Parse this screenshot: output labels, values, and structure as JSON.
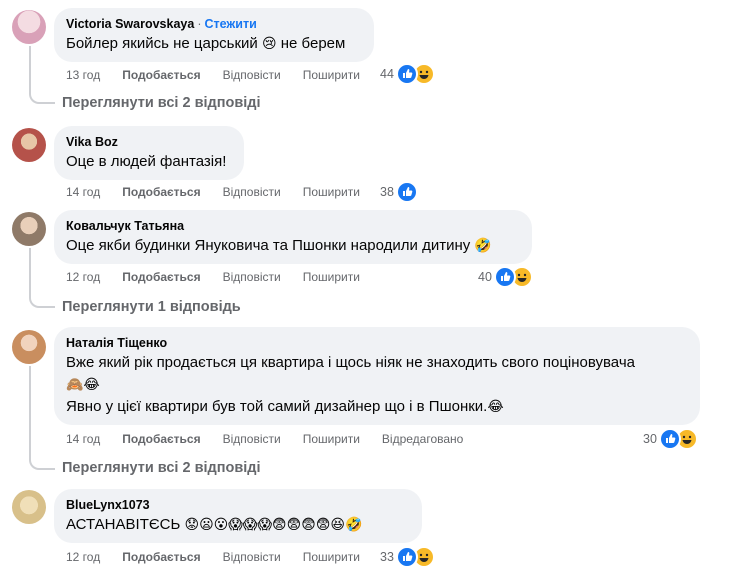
{
  "comments": [
    {
      "author": "Victoria Swarovskaya",
      "follow": "Стежити",
      "text": "Бойлер якийсь не царський",
      "text_emoji": "😢",
      "text_after": " не берем",
      "time": "13 год",
      "like": "Подобається",
      "reply": "Відповісти",
      "share": "Поширити",
      "reaction_count": "44",
      "reactions": [
        "like-icon",
        "haha-icon"
      ],
      "view_replies": "Переглянути всі 2 відповіді",
      "avatar_color": "#d9a1b8"
    },
    {
      "author": "Vika Boz",
      "text": "Оце в людей фантазія!",
      "time": "14 год",
      "like": "Подобається",
      "reply": "Відповісти",
      "share": "Поширити",
      "reaction_count": "38",
      "reactions": [
        "like-icon"
      ],
      "avatar_color": "#b5524a"
    },
    {
      "author": "Ковальчук Татьяна",
      "text": "Оце якби будинки Януковича та Пшонки народили дитину",
      "text_emoji": "🤣",
      "time": "12 год",
      "like": "Подобається",
      "reply": "Відповісти",
      "share": "Поширити",
      "reaction_count": "40",
      "reactions": [
        "like-icon",
        "haha-icon"
      ],
      "view_replies": "Переглянути 1 відповідь",
      "avatar_color": "#8f7a68"
    },
    {
      "author": "Наталія Тіщенко",
      "text_line1": "Вже який рік продається ця квартира і щось ніяк не знаходить свого поціновувача",
      "text_line2_emoji": "🙈😂",
      "text_line3": "Явно у цієї квартири був той самий дизайнер що і в Пшонки.",
      "text_line3_emoji": "😂",
      "time": "14 год",
      "like": "Подобається",
      "reply": "Відповісти",
      "share": "Поширити",
      "edited": "Відредаговано",
      "reaction_count": "30",
      "reactions": [
        "like-icon",
        "haha-icon"
      ],
      "view_replies": "Переглянути всі 2 відповіді",
      "avatar_color": "#c98e5f"
    },
    {
      "author": "BlueLynx1073",
      "text": "АСТАНАВІТЄСЬ",
      "text_emoji": "😟😦😮😱😱😱😨😨😨😨😆🤣",
      "time": "12 год",
      "like": "Подобається",
      "reply": "Відповісти",
      "share": "Поширити",
      "reaction_count": "33",
      "reactions": [
        "like-icon",
        "haha-icon"
      ],
      "avatar_color": "#d8c08a"
    }
  ]
}
